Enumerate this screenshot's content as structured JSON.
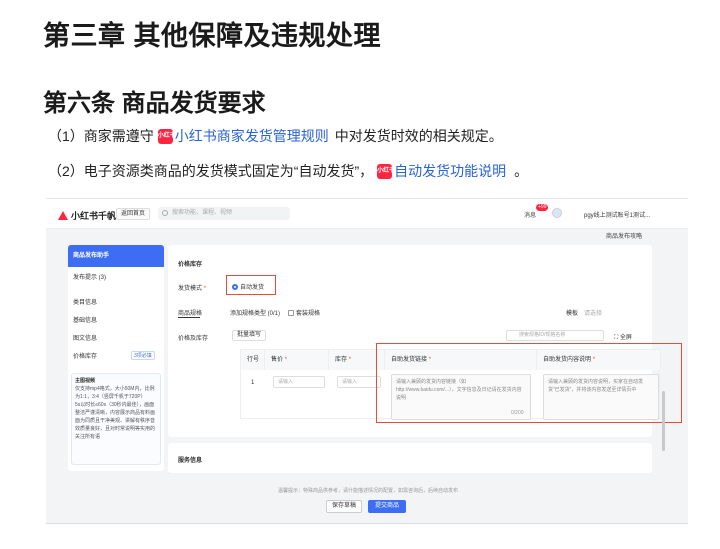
{
  "doc": {
    "chapter_title": "第三章 其他保障及违规处理",
    "article_title": "第六条 商品发货要求",
    "para1": {
      "prefix": "（1）商家需遵守",
      "badge": "小红书",
      "link": "小红书商家发货管理规则",
      "suffix": "中对发货时效的相关规定。"
    },
    "para2": {
      "prefix": "（2）电子资源类商品的发货模式固定为“自动发货”，",
      "badge": "小红书",
      "link": "自动发货功能说明",
      "suffix": "。"
    }
  },
  "screenshot": {
    "logo": "小红书千帆",
    "home_button": "返回首页",
    "search_placeholder": "搜索功能、课程、视频",
    "messages": "消息",
    "message_badge": "+99",
    "account": "pgy线上测试账号1测试...",
    "publish_help": "商品发布攻略",
    "nav": {
      "header": "商品发布助手",
      "items": [
        "发布提示 (3)",
        "类目信息",
        "基础信息",
        "图文信息",
        "价格库存"
      ],
      "price_tag": "3项必填",
      "tip_title": "主图视频",
      "tips": [
        "仅支持mp4格式，大小50M内，比例为1:1，3:4（竖屏千帆于720P）",
        "5s以时长≤60s（30秒内最佳），画面整洁严谨清晰，内容展示商品有料画面为同质且干净美观、讲解有秩序音效质量良好，且对时常说明等实用的关注所有语"
      ]
    },
    "main": {
      "section_price": "价格库存",
      "delivery_mode_label": "发货模式",
      "delivery_mode_value": "自动发货",
      "spec_label": "商品规格",
      "add_spec_type": "添加规格类型 (0/1)",
      "spec_check": "套装规格",
      "template_label": "模板",
      "template_value": "请选择",
      "price_stock_label": "价格及库存",
      "batch_fill": "批量填写",
      "table_search": "搜索规格ID/规格名称",
      "fullscreen": "全屏",
      "columns": [
        "行号",
        "售价",
        "库存",
        "自助发货链接",
        "自助发货内容说明"
      ],
      "row_index": "1",
      "price_placeholder": "请输入",
      "stock_placeholder": "请输入",
      "link_placeholder": "请输入兼顾的发货内容链接（如http://www.baidu.com/...），文字信息及日记请在发货内容说明",
      "link_counter": "0/200",
      "desc_placeholder": "请输入兼顾的发货内容说明，买家在自动发货“已发货”，并将该内容发送至详情页中"
    },
    "service_info": "服务信息",
    "footnote": "温馨提示：特殊商品供参考，请什能描述情况的配置，如需咨询后，后续自动发布",
    "save_draft": "保存草稿",
    "submit": "提交商品"
  },
  "colors": {
    "link": "#2a62d9",
    "brand_red": "#ff2442",
    "primary_blue": "#3d6df2",
    "highlight_border": "#e84b3c"
  }
}
